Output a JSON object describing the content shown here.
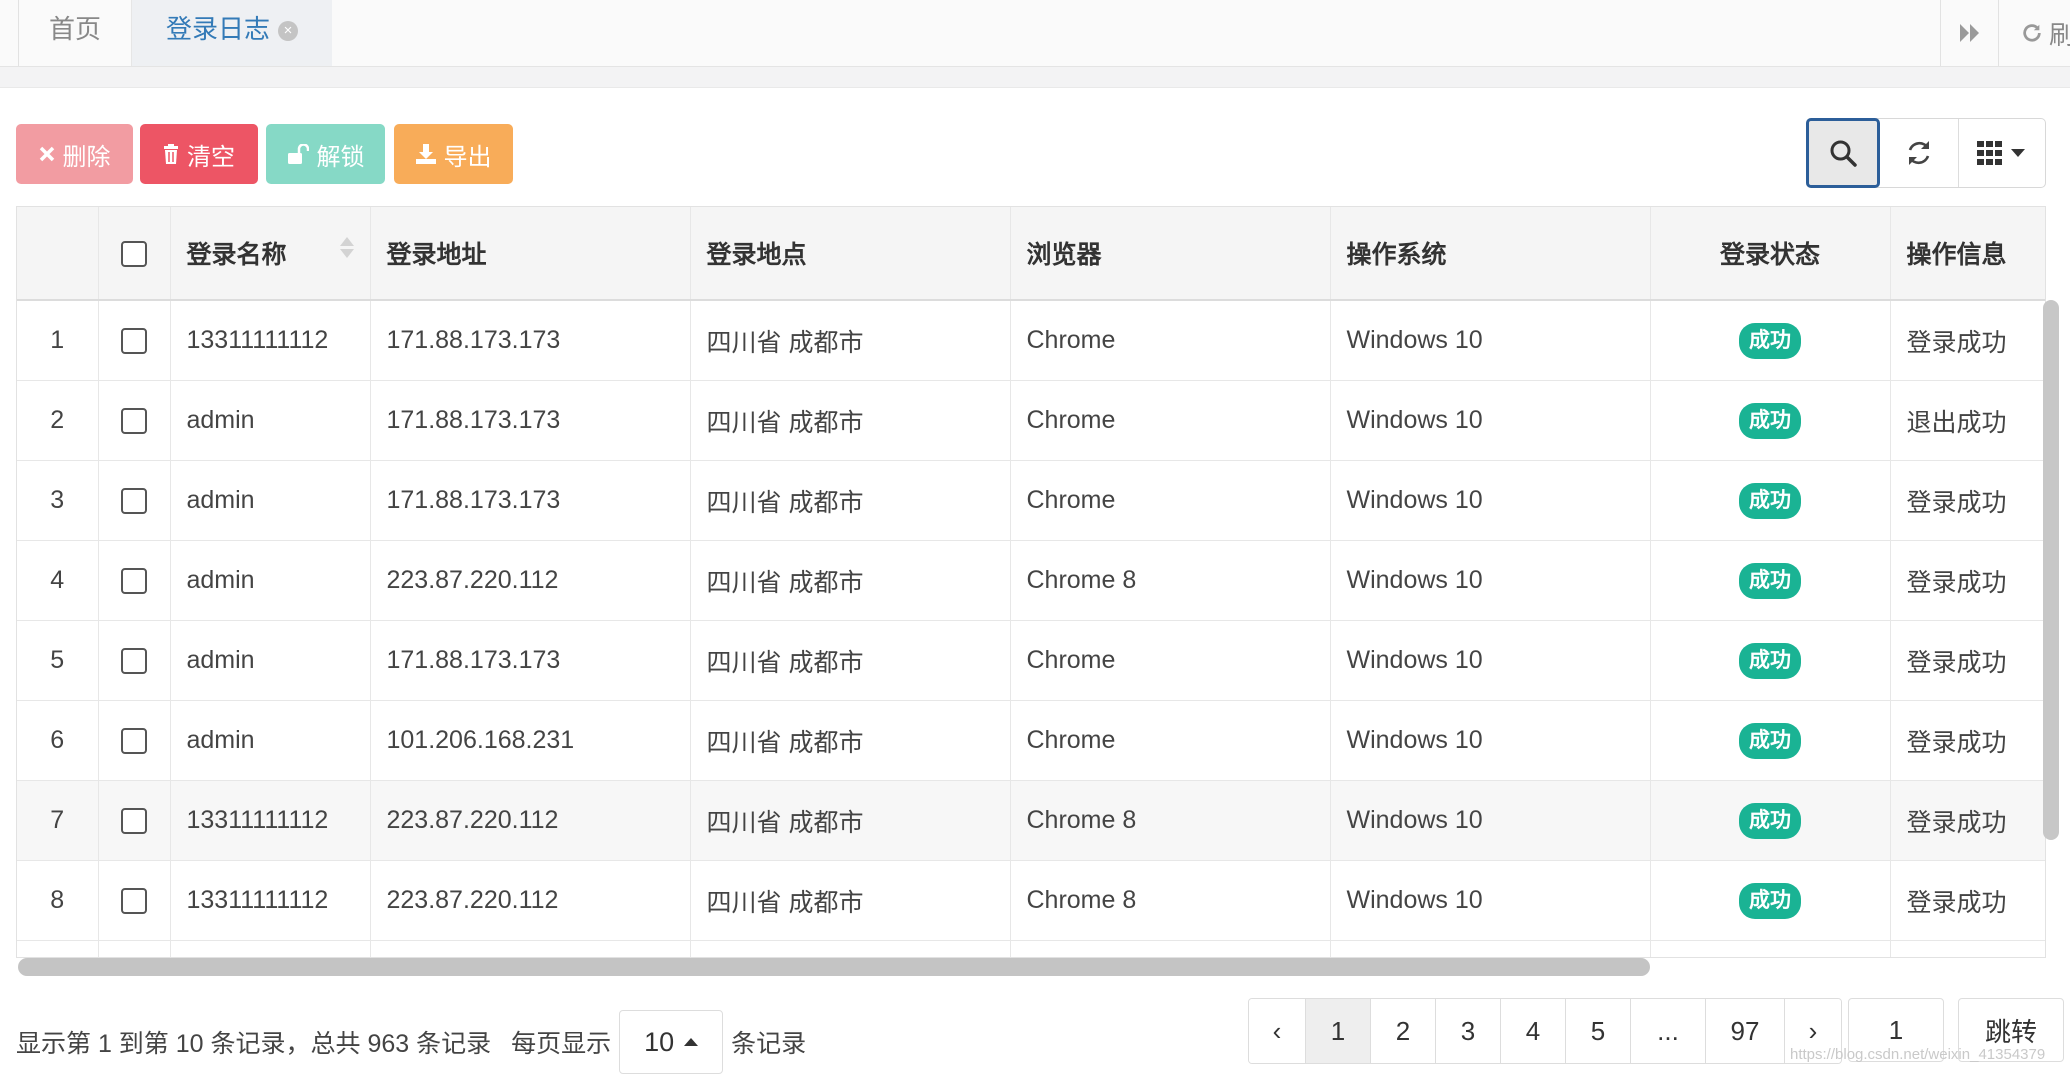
{
  "tabs": {
    "home": "首页",
    "active": "登录日志",
    "refresh_label": "刷"
  },
  "toolbar": {
    "delete": "删除",
    "clear": "清空",
    "unlock": "解锁",
    "export": "导出"
  },
  "table": {
    "headers": [
      "登录名称",
      "登录地址",
      "登录地点",
      "浏览器",
      "操作系统",
      "登录状态",
      "操作信息"
    ],
    "rows": [
      {
        "idx": "1",
        "name": "13311111112",
        "ip": "171.88.173.173",
        "location": "四川省 成都市",
        "browser": "Chrome",
        "os": "Windows 10",
        "status": "成功",
        "msg": "登录成功"
      },
      {
        "idx": "2",
        "name": "admin",
        "ip": "171.88.173.173",
        "location": "四川省 成都市",
        "browser": "Chrome",
        "os": "Windows 10",
        "status": "成功",
        "msg": "退出成功"
      },
      {
        "idx": "3",
        "name": "admin",
        "ip": "171.88.173.173",
        "location": "四川省 成都市",
        "browser": "Chrome",
        "os": "Windows 10",
        "status": "成功",
        "msg": "登录成功"
      },
      {
        "idx": "4",
        "name": "admin",
        "ip": "223.87.220.112",
        "location": "四川省 成都市",
        "browser": "Chrome 8",
        "os": "Windows 10",
        "status": "成功",
        "msg": "登录成功"
      },
      {
        "idx": "5",
        "name": "admin",
        "ip": "171.88.173.173",
        "location": "四川省 成都市",
        "browser": "Chrome",
        "os": "Windows 10",
        "status": "成功",
        "msg": "登录成功"
      },
      {
        "idx": "6",
        "name": "admin",
        "ip": "101.206.168.231",
        "location": "四川省 成都市",
        "browser": "Chrome",
        "os": "Windows 10",
        "status": "成功",
        "msg": "登录成功"
      },
      {
        "idx": "7",
        "name": "13311111112",
        "ip": "223.87.220.112",
        "location": "四川省 成都市",
        "browser": "Chrome 8",
        "os": "Windows 10",
        "status": "成功",
        "msg": "登录成功"
      },
      {
        "idx": "8",
        "name": "13311111112",
        "ip": "223.87.220.112",
        "location": "四川省 成都市",
        "browser": "Chrome 8",
        "os": "Windows 10",
        "status": "成功",
        "msg": "登录成功"
      }
    ]
  },
  "pagination": {
    "info": "显示第 1 到第 10 条记录，总共 963 条记录",
    "per_page_label": "每页显示",
    "page_size": "10",
    "records_label": "条记录",
    "prev": "‹",
    "pages": [
      "1",
      "2",
      "3",
      "4",
      "5",
      "...",
      "97"
    ],
    "next": "›",
    "jump_value": "1",
    "jump_label": "跳转"
  },
  "watermark": "https://blog.csdn.net/weixin_41354379",
  "colors": {
    "danger_light": "#f29ca2",
    "danger": "#ed5565",
    "info_light": "#86d9c6",
    "warning": "#f8ac59",
    "success_badge": "#1ab394",
    "active_tab_text": "#337ab7"
  }
}
